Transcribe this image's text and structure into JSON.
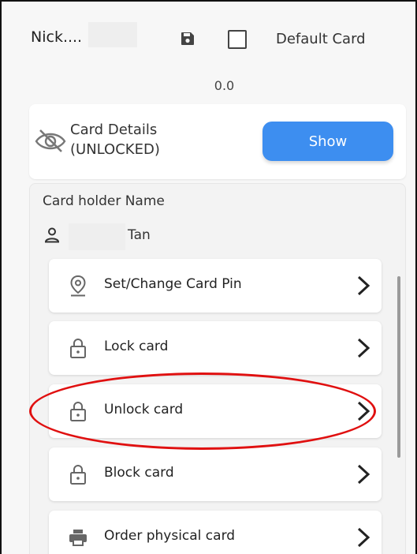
{
  "header": {
    "nickname_label": "Nick....",
    "default_card_label": "Default Card",
    "default_card_checked": false
  },
  "balance": "0.0",
  "card_details": {
    "title": "Card Details",
    "status": "(UNLOCKED)",
    "show_button": "Show",
    "icons": {
      "visibility": "eye-off-icon"
    }
  },
  "holder": {
    "label": "Card holder Name",
    "name": "Tan"
  },
  "actions": [
    {
      "label": "Set/Change Card Pin",
      "icon": "location-pin-icon"
    },
    {
      "label": "Lock card",
      "icon": "lock-icon"
    },
    {
      "label": "Unlock card",
      "icon": "lock-icon"
    },
    {
      "label": "Block card",
      "icon": "lock-icon"
    },
    {
      "label": "Order physical card",
      "icon": "printer-icon"
    }
  ],
  "colors": {
    "accent": "#3d8ef0",
    "highlight": "#e01010"
  }
}
